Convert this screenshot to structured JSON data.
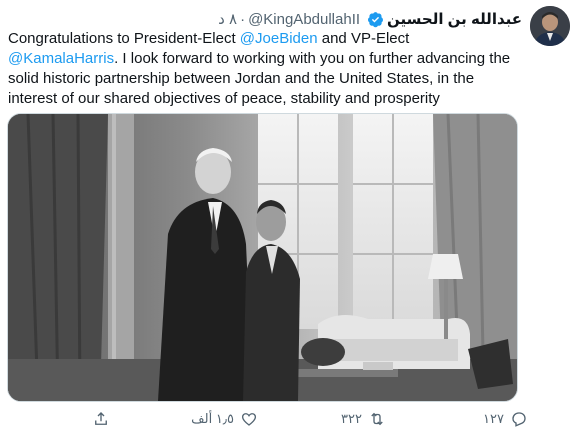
{
  "tweet": {
    "author_name": "عبدالله بن الحسين",
    "handle": "@KingAbdullahII",
    "time": "٨ د",
    "text_parts": {
      "p1": "Congratulations to President-Elect ",
      "mention1": "@JoeBiden",
      "p2": " and VP-Elect ",
      "mention2": "@KamalaHarris",
      "p3": ". I look forward to working with you on further advancing the solid historic partnership between Jordan and the United States, in the interest of our shared objectives of peace, stability and prosperity"
    }
  },
  "actions": {
    "replies": "١٢٧",
    "retweets": "٣٢٢",
    "likes": "١٫٥ ألف"
  },
  "icons": {
    "verified": "verified-badge-icon",
    "reply": "reply-icon",
    "retweet": "retweet-icon",
    "like": "heart-icon",
    "share": "share-icon"
  },
  "colors": {
    "accent": "#1d9bf0",
    "muted": "#536471",
    "text": "#0f1419"
  }
}
